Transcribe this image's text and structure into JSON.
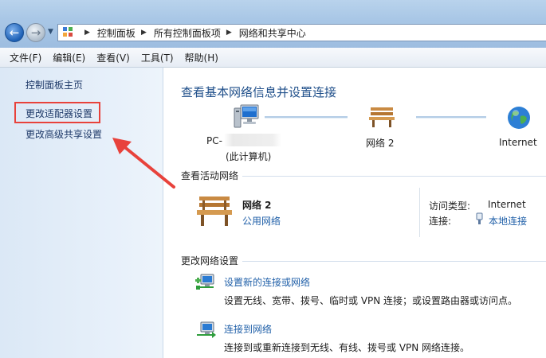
{
  "address_bar": {
    "crumbs": [
      "控制面板",
      "所有控制面板项",
      "网络和共享中心"
    ],
    "icon": "control-panel-icon"
  },
  "menu": [
    "文件(F)",
    "编辑(E)",
    "查看(V)",
    "工具(T)",
    "帮助(H)"
  ],
  "left_pane": {
    "home": "控制面板主页",
    "adapter": "更改适配器设置",
    "advanced": "更改高级共享设置",
    "highlight_color": "#e8423b"
  },
  "main": {
    "title": "查看基本网络信息并设置连接",
    "map": {
      "computer_name": "PC-",
      "computer_sub": "(此计算机)",
      "network_name": "网络 2",
      "internet": "Internet"
    },
    "active_section": "查看活动网络",
    "active_network": {
      "name": "网络 2",
      "category": "公用网络",
      "access_label": "访问类型:",
      "access_value": "Internet",
      "connection_label": "连接:",
      "connection_value": "本地连接"
    },
    "change_section": "更改网络设置",
    "tasks": [
      {
        "title": "设置新的连接或网络",
        "desc": "设置无线、宽带、拨号、临时或 VPN 连接；或设置路由器或访问点。"
      },
      {
        "title": "连接到网络",
        "desc": "连接到或重新连接到无线、有线、拨号或 VPN 网络连接。"
      }
    ]
  },
  "colors": {
    "link": "#1f5fa8",
    "title": "#1f4f8a",
    "accent_red": "#e8423b"
  }
}
